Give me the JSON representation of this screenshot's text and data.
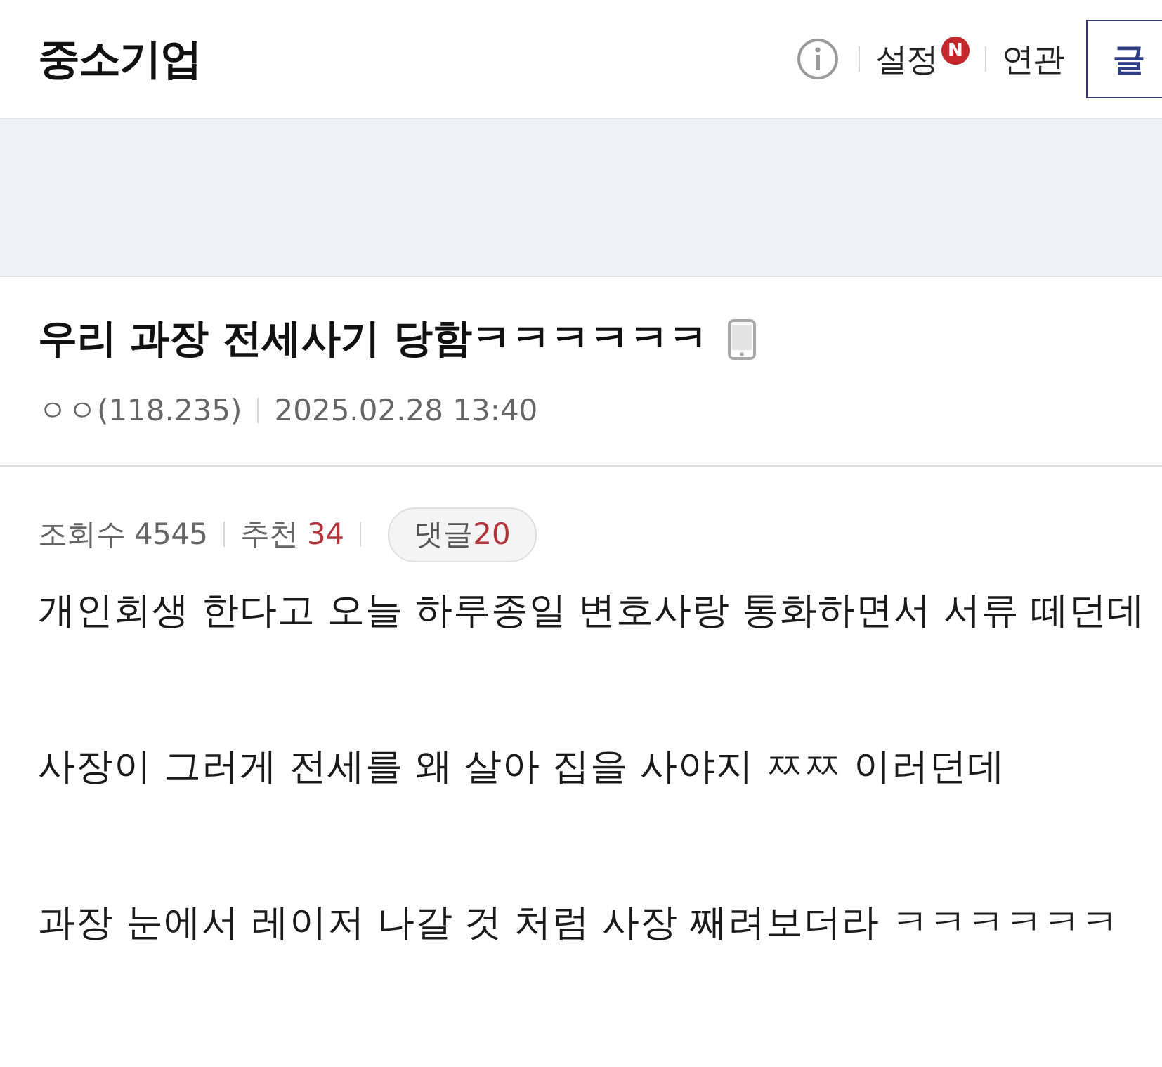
{
  "header": {
    "title": "중소기업",
    "links": [
      {
        "label": "설정",
        "badge": "N"
      },
      {
        "label": "연관"
      }
    ],
    "write_button": "글"
  },
  "post": {
    "title": "우리 과장 전세사기 당함ㅋㅋㅋㅋㅋㅋ",
    "mobile": true,
    "author": "ㅇㅇ(118.235)",
    "date": "2025.02.28 13:40"
  },
  "stats": [
    {
      "kind": "plain",
      "label": "조회수",
      "value": "4545"
    },
    {
      "kind": "highlight",
      "label": "추천",
      "value": "34"
    },
    {
      "kind": "pill",
      "label": "댓글",
      "value": "20"
    }
  ],
  "body": [
    "개인회생 한다고 오늘 하루종일 변호사랑 통화하면서 서류 떼던데",
    "사장이 그러게 전세를 왜 살아 집을 사야지 ㅉㅉ 이러던데",
    "과장 눈에서 레이저 나갈 것 처럼 사장 째려보더라 ㅋㅋㅋㅋㅋㅋ"
  ]
}
